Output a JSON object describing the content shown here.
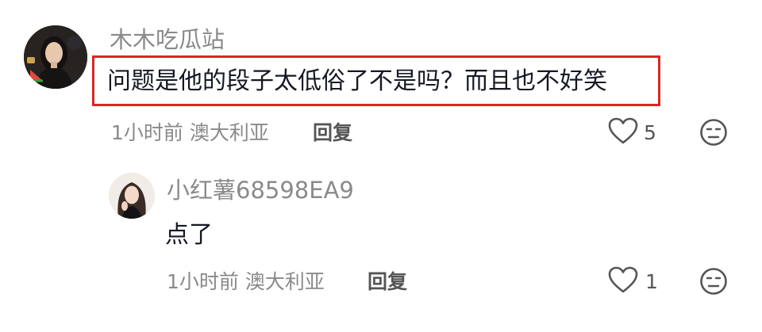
{
  "comment": {
    "username": "木木吃瓜站",
    "text": "问题是他的段子太低俗了不是吗？而且也不好笑",
    "meta": "1小时前 澳大利亚",
    "reply_label": "回复",
    "likes": "5",
    "highlight_color": "#e02424"
  },
  "reply": {
    "username": "小红薯68598EA9",
    "text": "点了",
    "meta": "1小时前 澳大利亚",
    "reply_label": "回复",
    "likes": "1"
  },
  "icons": {
    "like": "heart-outline-icon",
    "dislike": "meh-face-icon"
  }
}
